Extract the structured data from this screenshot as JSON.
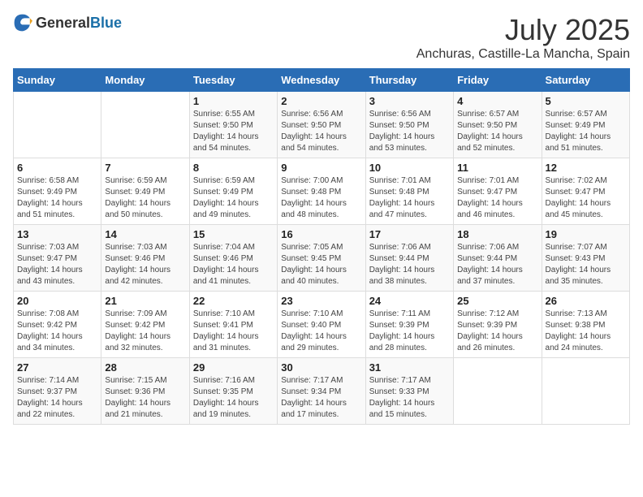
{
  "header": {
    "logo_general": "General",
    "logo_blue": "Blue",
    "title": "July 2025",
    "subtitle": "Anchuras, Castille-La Mancha, Spain"
  },
  "columns": [
    "Sunday",
    "Monday",
    "Tuesday",
    "Wednesday",
    "Thursday",
    "Friday",
    "Saturday"
  ],
  "weeks": [
    [
      {
        "day": "",
        "sunrise": "",
        "sunset": "",
        "daylight": ""
      },
      {
        "day": "",
        "sunrise": "",
        "sunset": "",
        "daylight": ""
      },
      {
        "day": "1",
        "sunrise": "Sunrise: 6:55 AM",
        "sunset": "Sunset: 9:50 PM",
        "daylight": "Daylight: 14 hours and 54 minutes."
      },
      {
        "day": "2",
        "sunrise": "Sunrise: 6:56 AM",
        "sunset": "Sunset: 9:50 PM",
        "daylight": "Daylight: 14 hours and 54 minutes."
      },
      {
        "day": "3",
        "sunrise": "Sunrise: 6:56 AM",
        "sunset": "Sunset: 9:50 PM",
        "daylight": "Daylight: 14 hours and 53 minutes."
      },
      {
        "day": "4",
        "sunrise": "Sunrise: 6:57 AM",
        "sunset": "Sunset: 9:50 PM",
        "daylight": "Daylight: 14 hours and 52 minutes."
      },
      {
        "day": "5",
        "sunrise": "Sunrise: 6:57 AM",
        "sunset": "Sunset: 9:49 PM",
        "daylight": "Daylight: 14 hours and 51 minutes."
      }
    ],
    [
      {
        "day": "6",
        "sunrise": "Sunrise: 6:58 AM",
        "sunset": "Sunset: 9:49 PM",
        "daylight": "Daylight: 14 hours and 51 minutes."
      },
      {
        "day": "7",
        "sunrise": "Sunrise: 6:59 AM",
        "sunset": "Sunset: 9:49 PM",
        "daylight": "Daylight: 14 hours and 50 minutes."
      },
      {
        "day": "8",
        "sunrise": "Sunrise: 6:59 AM",
        "sunset": "Sunset: 9:49 PM",
        "daylight": "Daylight: 14 hours and 49 minutes."
      },
      {
        "day": "9",
        "sunrise": "Sunrise: 7:00 AM",
        "sunset": "Sunset: 9:48 PM",
        "daylight": "Daylight: 14 hours and 48 minutes."
      },
      {
        "day": "10",
        "sunrise": "Sunrise: 7:01 AM",
        "sunset": "Sunset: 9:48 PM",
        "daylight": "Daylight: 14 hours and 47 minutes."
      },
      {
        "day": "11",
        "sunrise": "Sunrise: 7:01 AM",
        "sunset": "Sunset: 9:47 PM",
        "daylight": "Daylight: 14 hours and 46 minutes."
      },
      {
        "day": "12",
        "sunrise": "Sunrise: 7:02 AM",
        "sunset": "Sunset: 9:47 PM",
        "daylight": "Daylight: 14 hours and 45 minutes."
      }
    ],
    [
      {
        "day": "13",
        "sunrise": "Sunrise: 7:03 AM",
        "sunset": "Sunset: 9:47 PM",
        "daylight": "Daylight: 14 hours and 43 minutes."
      },
      {
        "day": "14",
        "sunrise": "Sunrise: 7:03 AM",
        "sunset": "Sunset: 9:46 PM",
        "daylight": "Daylight: 14 hours and 42 minutes."
      },
      {
        "day": "15",
        "sunrise": "Sunrise: 7:04 AM",
        "sunset": "Sunset: 9:46 PM",
        "daylight": "Daylight: 14 hours and 41 minutes."
      },
      {
        "day": "16",
        "sunrise": "Sunrise: 7:05 AM",
        "sunset": "Sunset: 9:45 PM",
        "daylight": "Daylight: 14 hours and 40 minutes."
      },
      {
        "day": "17",
        "sunrise": "Sunrise: 7:06 AM",
        "sunset": "Sunset: 9:44 PM",
        "daylight": "Daylight: 14 hours and 38 minutes."
      },
      {
        "day": "18",
        "sunrise": "Sunrise: 7:06 AM",
        "sunset": "Sunset: 9:44 PM",
        "daylight": "Daylight: 14 hours and 37 minutes."
      },
      {
        "day": "19",
        "sunrise": "Sunrise: 7:07 AM",
        "sunset": "Sunset: 9:43 PM",
        "daylight": "Daylight: 14 hours and 35 minutes."
      }
    ],
    [
      {
        "day": "20",
        "sunrise": "Sunrise: 7:08 AM",
        "sunset": "Sunset: 9:42 PM",
        "daylight": "Daylight: 14 hours and 34 minutes."
      },
      {
        "day": "21",
        "sunrise": "Sunrise: 7:09 AM",
        "sunset": "Sunset: 9:42 PM",
        "daylight": "Daylight: 14 hours and 32 minutes."
      },
      {
        "day": "22",
        "sunrise": "Sunrise: 7:10 AM",
        "sunset": "Sunset: 9:41 PM",
        "daylight": "Daylight: 14 hours and 31 minutes."
      },
      {
        "day": "23",
        "sunrise": "Sunrise: 7:10 AM",
        "sunset": "Sunset: 9:40 PM",
        "daylight": "Daylight: 14 hours and 29 minutes."
      },
      {
        "day": "24",
        "sunrise": "Sunrise: 7:11 AM",
        "sunset": "Sunset: 9:39 PM",
        "daylight": "Daylight: 14 hours and 28 minutes."
      },
      {
        "day": "25",
        "sunrise": "Sunrise: 7:12 AM",
        "sunset": "Sunset: 9:39 PM",
        "daylight": "Daylight: 14 hours and 26 minutes."
      },
      {
        "day": "26",
        "sunrise": "Sunrise: 7:13 AM",
        "sunset": "Sunset: 9:38 PM",
        "daylight": "Daylight: 14 hours and 24 minutes."
      }
    ],
    [
      {
        "day": "27",
        "sunrise": "Sunrise: 7:14 AM",
        "sunset": "Sunset: 9:37 PM",
        "daylight": "Daylight: 14 hours and 22 minutes."
      },
      {
        "day": "28",
        "sunrise": "Sunrise: 7:15 AM",
        "sunset": "Sunset: 9:36 PM",
        "daylight": "Daylight: 14 hours and 21 minutes."
      },
      {
        "day": "29",
        "sunrise": "Sunrise: 7:16 AM",
        "sunset": "Sunset: 9:35 PM",
        "daylight": "Daylight: 14 hours and 19 minutes."
      },
      {
        "day": "30",
        "sunrise": "Sunrise: 7:17 AM",
        "sunset": "Sunset: 9:34 PM",
        "daylight": "Daylight: 14 hours and 17 minutes."
      },
      {
        "day": "31",
        "sunrise": "Sunrise: 7:17 AM",
        "sunset": "Sunset: 9:33 PM",
        "daylight": "Daylight: 14 hours and 15 minutes."
      },
      {
        "day": "",
        "sunrise": "",
        "sunset": "",
        "daylight": ""
      },
      {
        "day": "",
        "sunrise": "",
        "sunset": "",
        "daylight": ""
      }
    ]
  ]
}
